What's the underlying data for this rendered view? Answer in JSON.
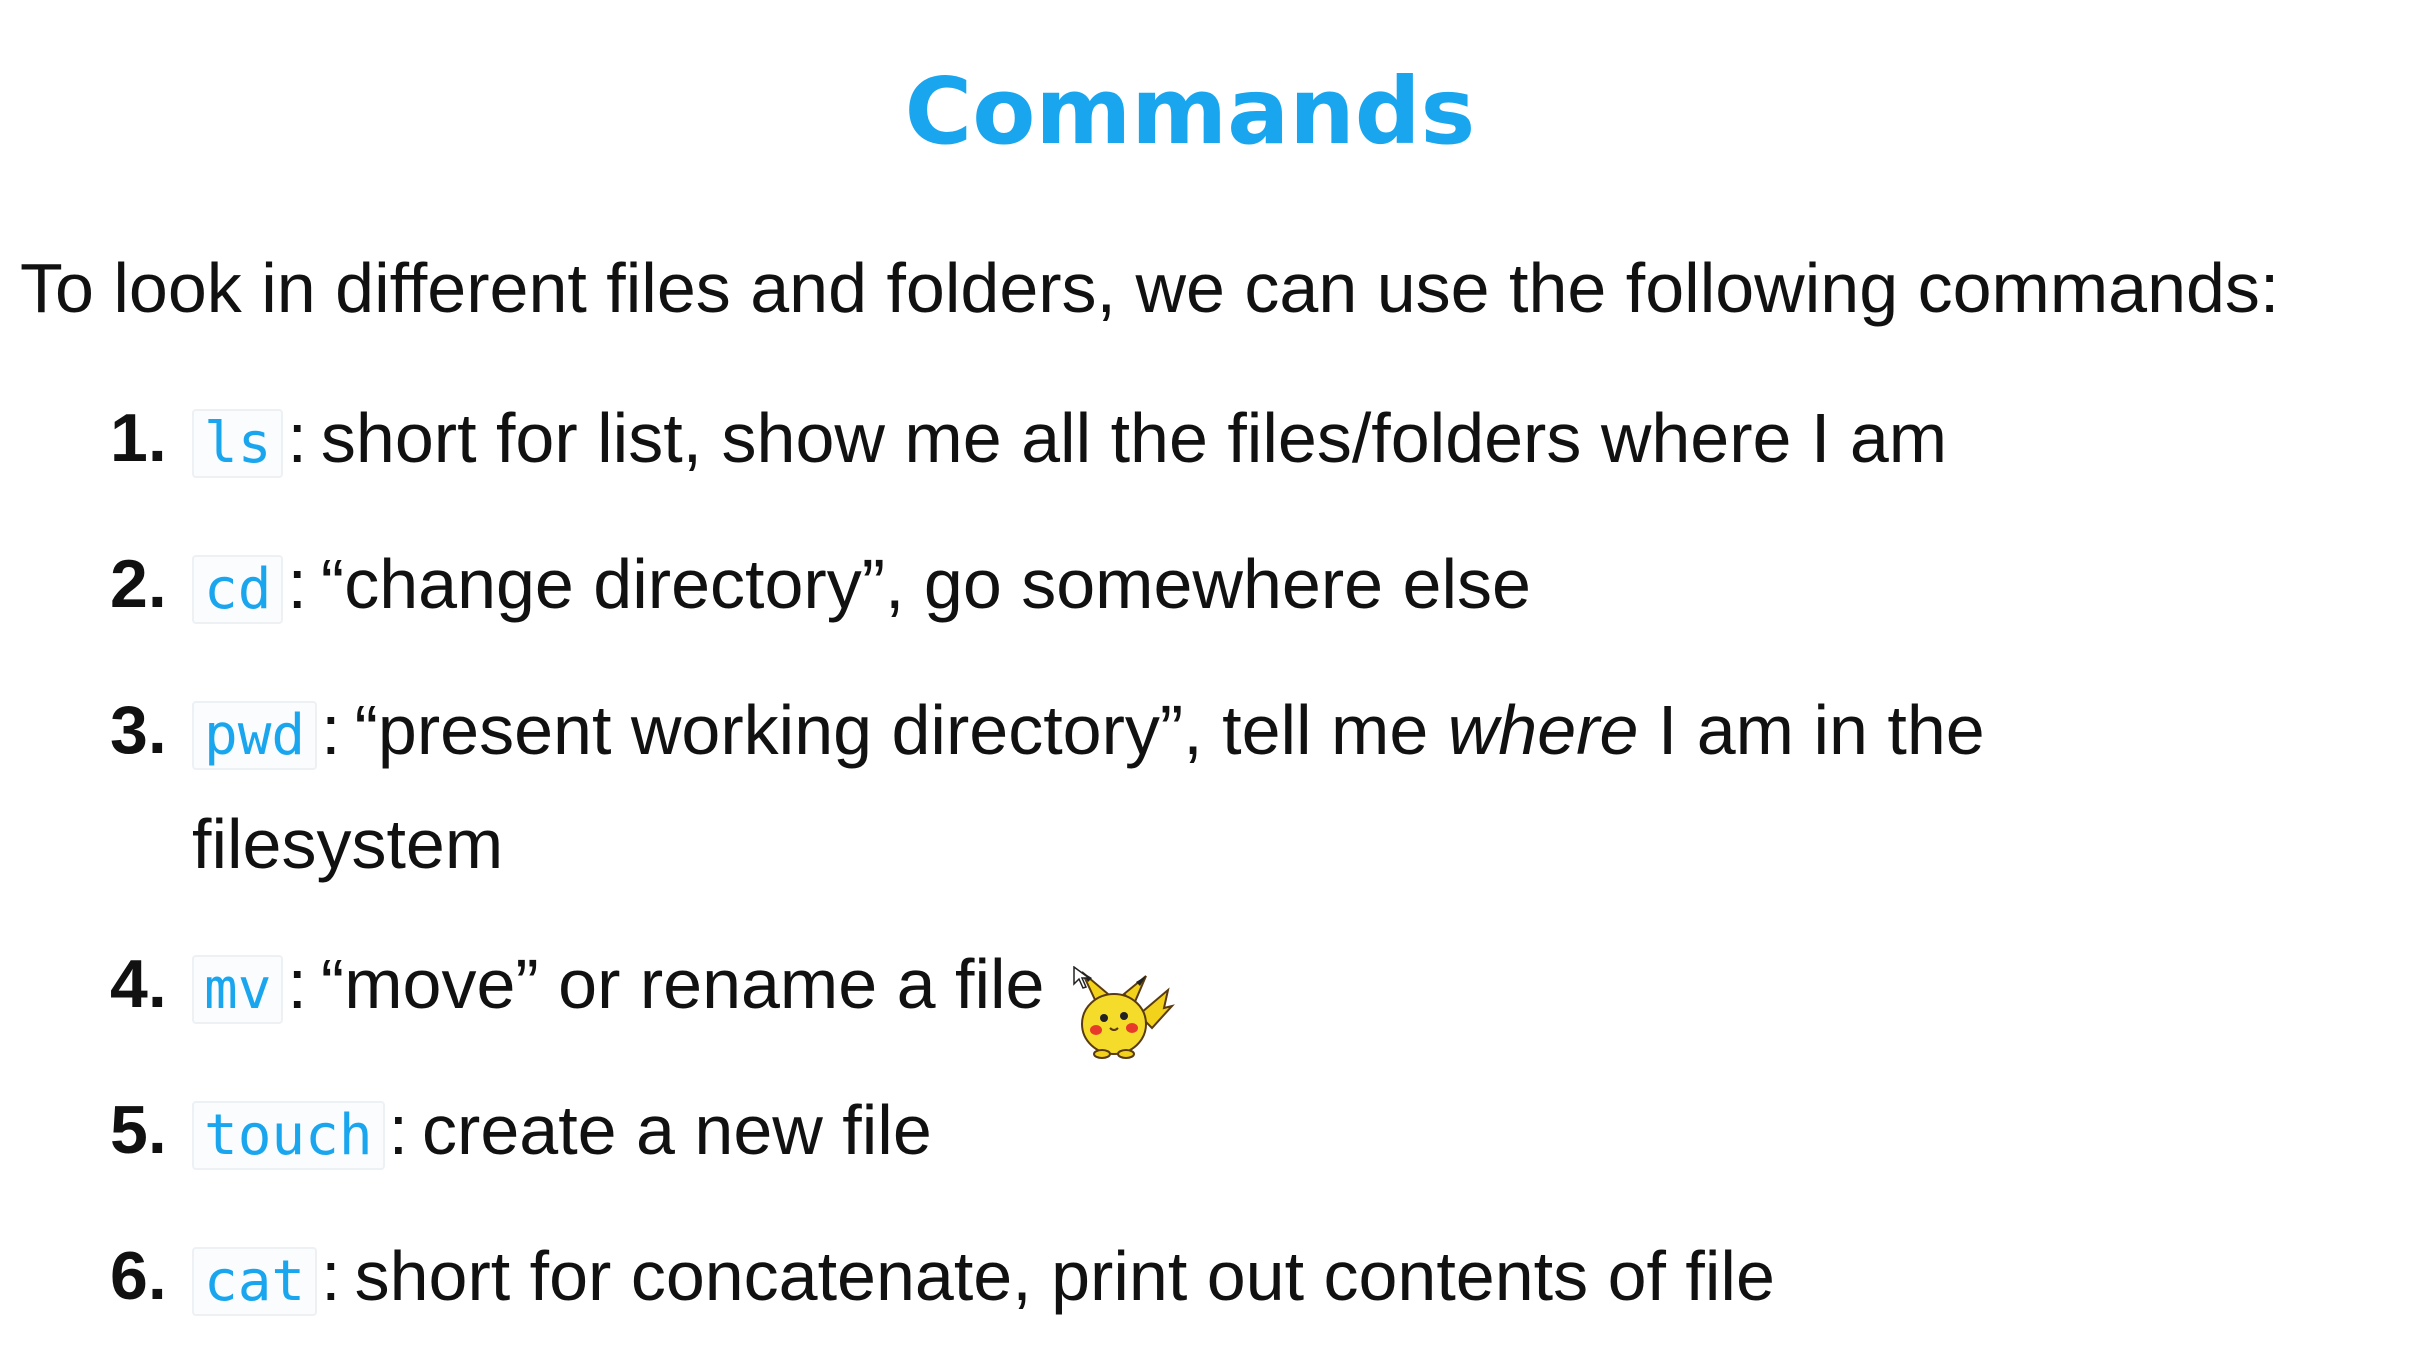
{
  "slide": {
    "title": "Commands",
    "intro": "To look in different files and folders, we can use the following commands:"
  },
  "commands": [
    {
      "number": "1.",
      "code": "ls",
      "desc": "short for list, show me all the files/folders where I am"
    },
    {
      "number": "2.",
      "code": "cd",
      "desc": "“change directory”, go somewhere else"
    },
    {
      "number": "3.",
      "code": "pwd",
      "desc_before": "“present working directory”, tell me ",
      "desc_em": "where",
      "desc_after": " I am in the filesystem"
    },
    {
      "number": "4.",
      "code": "mv",
      "desc": "“move” or rename a file"
    },
    {
      "number": "5.",
      "code": "touch",
      "desc": "create a new file"
    },
    {
      "number": "6.",
      "code": "cat",
      "desc": "short for concatenate, print out contents of file"
    }
  ],
  "colors": {
    "accent": "#1aa6ee",
    "text": "#111111",
    "code_bg": "#fafcfd"
  },
  "icons": {
    "cursor": "pikachu-cursor-icon"
  }
}
